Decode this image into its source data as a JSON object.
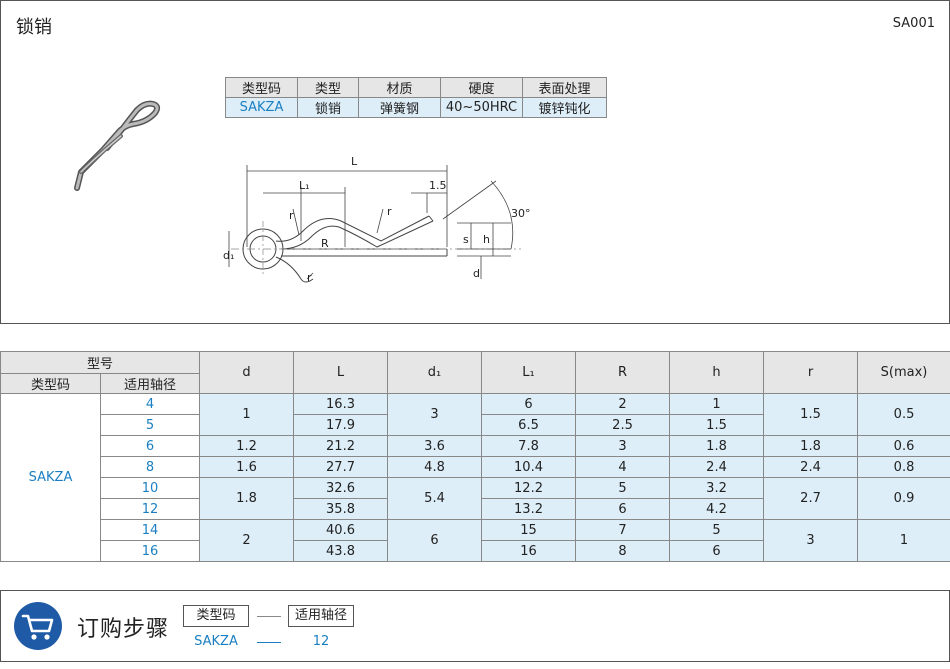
{
  "header": {
    "title": "锁销",
    "code": "SA001"
  },
  "spec": {
    "headers": [
      "类型码",
      "类型",
      "材质",
      "硬度",
      "表面处理"
    ],
    "values": [
      "SAKZA",
      "锁销",
      "弹簧钢",
      "40~50HRC",
      "镀锌钝化"
    ]
  },
  "drawing": {
    "labels": {
      "L": "L",
      "L1": "L₁",
      "pitch": "1.5",
      "angle": "30°",
      "r": "r",
      "R": "R",
      "s": "s",
      "h": "h",
      "d": "d",
      "d1": "d₁"
    }
  },
  "table": {
    "model_header": "型号",
    "type_code_header": "类型码",
    "shaft_header": "适用轴径",
    "columns": [
      "d",
      "L",
      "d₁",
      "L₁",
      "R",
      "h",
      "r",
      "S(max)"
    ],
    "type_code": "SAKZA",
    "shaft": [
      "4",
      "5",
      "6",
      "8",
      "10",
      "12",
      "14",
      "16"
    ],
    "L": [
      "16.3",
      "17.9",
      "21.2",
      "27.7",
      "32.6",
      "35.8",
      "40.6",
      "43.8"
    ],
    "L1": [
      "6",
      "6.5",
      "7.8",
      "10.4",
      "12.2",
      "13.2",
      "15",
      "16"
    ],
    "R": [
      "2",
      "2.5",
      "3",
      "4",
      "5",
      "6",
      "7",
      "8"
    ],
    "h": [
      "1",
      "1.5",
      "1.8",
      "2.4",
      "3.2",
      "4.2",
      "5",
      "6"
    ],
    "d": [
      "1",
      "1.2",
      "1.6",
      "1.8",
      "2"
    ],
    "d1": [
      "3",
      "3.6",
      "4.8",
      "5.4",
      "6"
    ],
    "r": [
      "1.5",
      "1.8",
      "2.4",
      "2.7",
      "3"
    ],
    "S": [
      "0.5",
      "0.6",
      "0.8",
      "0.9",
      "1"
    ]
  },
  "order": {
    "title": "订购步骤",
    "box1": "类型码",
    "box2": "适用轴径",
    "value1": "SAKZA",
    "value2": "12",
    "accent": "#1f5aa6"
  }
}
